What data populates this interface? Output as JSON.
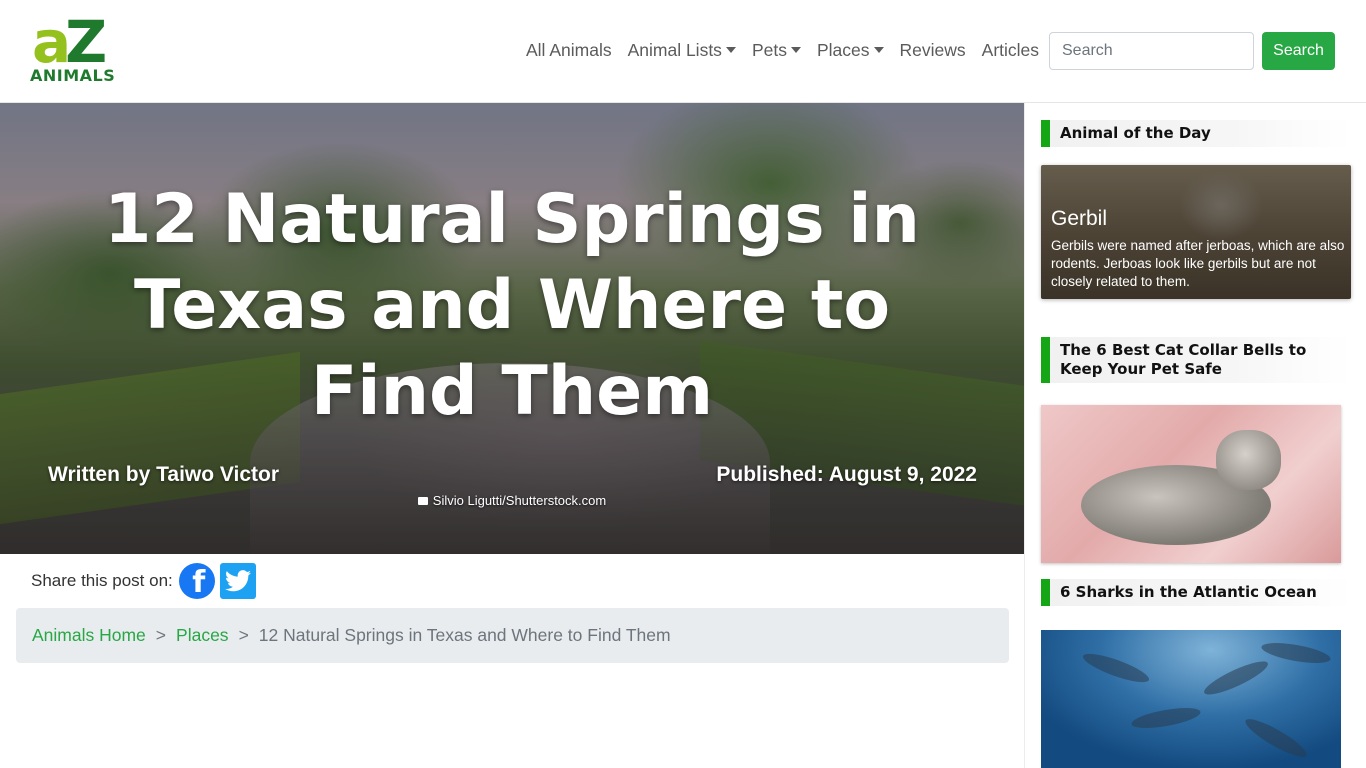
{
  "logo": {
    "mark_a": "a",
    "mark_z": "Z",
    "word": "ANIMALS",
    "colors": {
      "light": "#95c11f",
      "dark": "#1f7a2e"
    }
  },
  "nav": {
    "items": [
      {
        "label": "All Animals",
        "dropdown": false
      },
      {
        "label": "Animal Lists",
        "dropdown": true
      },
      {
        "label": "Pets",
        "dropdown": true
      },
      {
        "label": "Places",
        "dropdown": true
      },
      {
        "label": "Reviews",
        "dropdown": false
      },
      {
        "label": "Articles",
        "dropdown": false
      }
    ]
  },
  "search": {
    "placeholder": "Search",
    "button_label": "Search",
    "button_color": "#28a745"
  },
  "hero": {
    "title": "12 Natural Springs in Texas and Where to Find Them",
    "author_prefix": "Written by ",
    "author_name": "Taiwo Victor",
    "published": "Published: August 9, 2022",
    "photo_credit": "Silvio Ligutti/Shutterstock.com"
  },
  "share": {
    "label": "Share this post on:",
    "icons": [
      "facebook-icon",
      "twitter-icon"
    ]
  },
  "breadcrumb": {
    "items": [
      {
        "label": "Animals Home"
      },
      {
        "label": "Places"
      }
    ],
    "separator": ">",
    "current": "12 Natural Springs in Texas and Where to Find Them"
  },
  "sidebar": {
    "accent": "#14a614",
    "sections": [
      {
        "heading": "Animal of the Day",
        "card_title": "Gerbil",
        "card_desc": "Gerbils were named after jerboas, which are also rodents. Jerboas look like gerbils but are not closely related to them."
      },
      {
        "heading": "The 6 Best Cat Collar Bells to Keep Your Pet Safe"
      },
      {
        "heading": "6 Sharks in the Atlantic Ocean"
      }
    ]
  }
}
